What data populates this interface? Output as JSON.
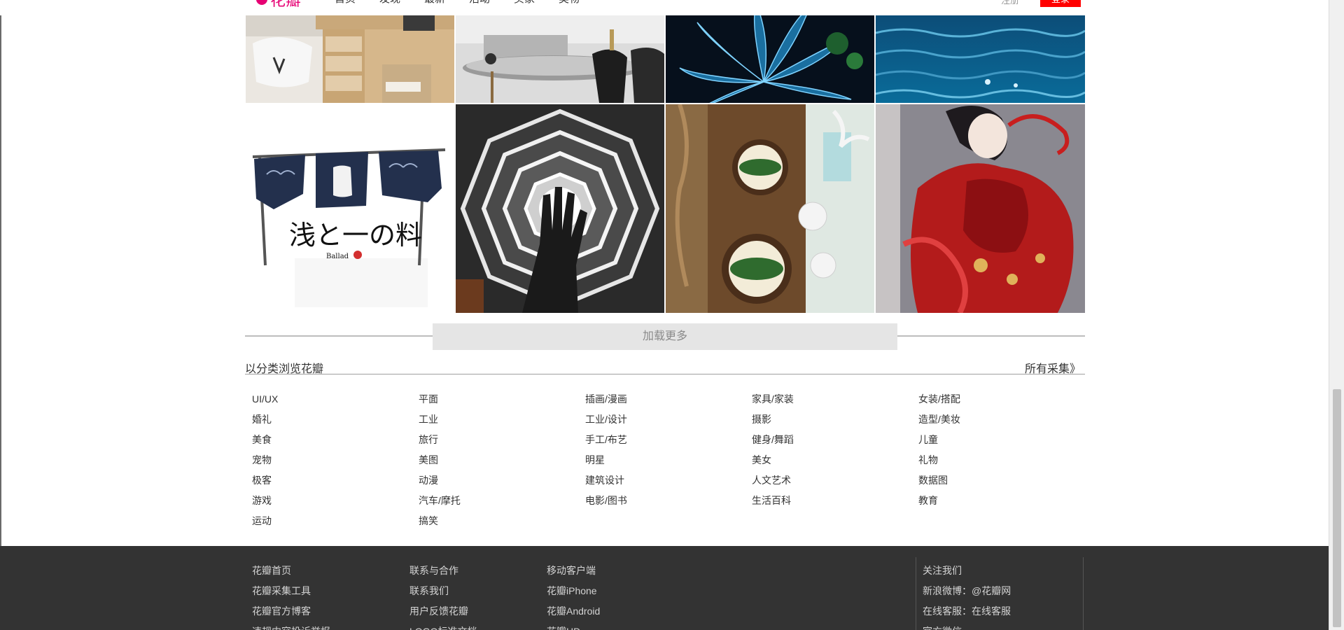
{
  "header": {
    "logo_text": "花瓣",
    "nav": [
      "首页",
      "发现",
      "最新",
      "活动",
      "买家",
      "美物"
    ],
    "login_label": "注册",
    "register_label": "登录"
  },
  "gallery": [
    {
      "name": "photo-white-desk-chair"
    },
    {
      "name": "photo-dining-room-black-chairs"
    },
    {
      "name": "photo-blue-leaf-dewdrops"
    },
    {
      "name": "photo-ocean-water"
    },
    {
      "name": "photo-japanese-noren-fish"
    },
    {
      "name": "photo-spiral-building-hand"
    },
    {
      "name": "photo-table-setting-leaves"
    },
    {
      "name": "photo-red-dress-illustration"
    }
  ],
  "load_more_label": "加载更多",
  "categories": {
    "title": "以分类浏览花瓣",
    "all_link": "所有采集》",
    "columns": [
      [
        "UI/UX",
        "婚礼",
        "美食",
        "宠物",
        "极客",
        "游戏",
        "运动"
      ],
      [
        "平面",
        "工业",
        "旅行",
        "美图",
        "动漫",
        "汽车/摩托",
        "搞笑"
      ],
      [
        "插画/漫画",
        "工业/设计",
        "手工/布艺",
        "明星",
        "建筑设计",
        "电影/图书"
      ],
      [
        "家具/家装",
        "摄影",
        "健身/舞蹈",
        "美女",
        "人文艺术",
        "生活百科"
      ],
      [
        "女装/搭配",
        "造型/美妆",
        "儿童",
        "礼物",
        "数据图",
        "教育"
      ]
    ]
  },
  "footer": {
    "col1": [
      "花瓣首页",
      "花瓣采集工具",
      "花瓣官方博客",
      "违规内容投诉举报"
    ],
    "col2": [
      "联系与合作",
      "联系我们",
      "用户反馈花瓣",
      "LOGO标准文档"
    ],
    "col3": [
      "移动客户端",
      "花瓣iPhone",
      "花瓣Android",
      "花瓣HD"
    ],
    "col4_head": "关注我们",
    "col4": [
      "新浪微博：@花瓣网",
      "在线客服：在线客服",
      "官方微信"
    ]
  }
}
